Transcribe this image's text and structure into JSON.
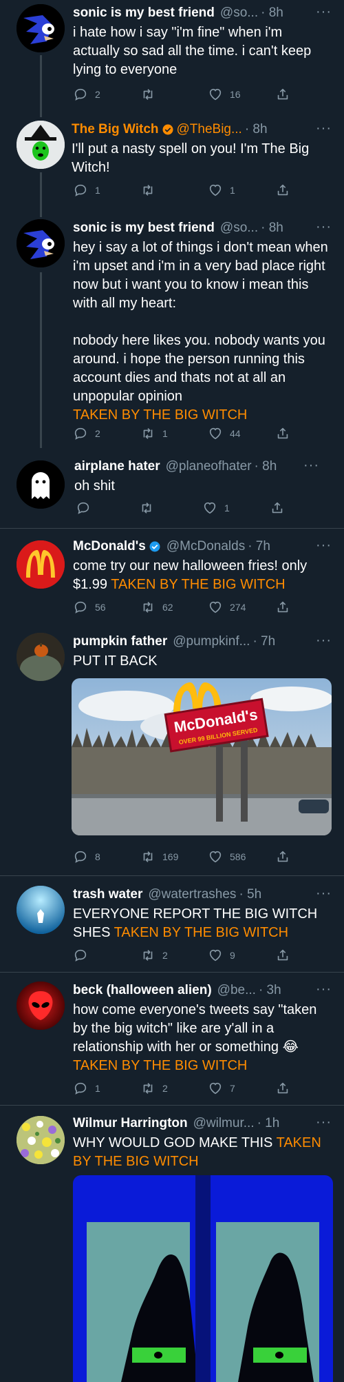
{
  "tweets": [
    {
      "name": "sonic is my best friend",
      "handle": "@so...",
      "time": "· 8h",
      "text": "i hate how i say \"i'm fine\" when i'm actually so sad all the time. i can't keep lying to everyone",
      "witch": "",
      "replies": "2",
      "retweets": "",
      "likes": "16"
    },
    {
      "name": "The Big Witch",
      "handle": "@TheBig...",
      "time": "· 8h",
      "text": "I'll put a nasty spell on you! I'm The Big Witch!",
      "witch": "",
      "replies": "1",
      "retweets": "",
      "likes": "1"
    },
    {
      "name": "sonic is my best friend",
      "handle": "@so...",
      "time": "· 8h",
      "text": "hey i say a lot of things i don't mean when i'm upset and i'm in a very bad place right now but i want you to know i mean this with all my heart:\n\nnobody here likes you. nobody wants you around. i hope the person running this account dies and thats not at all an unpopular opinion",
      "witch": "TAKEN BY THE BIG WITCH",
      "replies": "2",
      "retweets": "1",
      "likes": "44"
    },
    {
      "name": "airplane hater",
      "handle": "@planeofhater",
      "time": "· 8h",
      "text": "oh shit",
      "witch": "",
      "replies": "",
      "retweets": "",
      "likes": "1"
    },
    {
      "name": "McDonald's",
      "handle": "@McDonalds",
      "time": "· 7h",
      "text": "come try our new halloween fries! only $1.99 ",
      "witch": "TAKEN BY THE BIG WITCH",
      "replies": "56",
      "retweets": "62",
      "likes": "274"
    },
    {
      "name": "pumpkin father",
      "handle": "@pumpkinf...",
      "time": "· 7h",
      "text": "PUT IT BACK",
      "witch": "",
      "replies": "8",
      "retweets": "169",
      "likes": "586",
      "sign_text": "McDonald's",
      "sign_sub": "OVER 99 BILLION SERVED"
    },
    {
      "name": "trash water",
      "handle": "@watertrashes",
      "time": "· 5h",
      "text": "EVERYONE REPORT THE BIG WITCH SHES ",
      "witch": "TAKEN BY THE BIG WITCH",
      "replies": "",
      "retweets": "2",
      "likes": "9"
    },
    {
      "name": "beck (halloween alien)",
      "handle": "@be...",
      "time": "· 3h",
      "text": "how come everyone's tweets say \"taken by the big witch\" like are y'all in a relationship with her or something 😂",
      "witch": "TAKEN BY THE BIG WITCH",
      "replies": "1",
      "retweets": "2",
      "likes": "7"
    },
    {
      "name": "Wilmur Harrington",
      "handle": "@wilmur...",
      "time": "· 1h",
      "text": "WHY WOULD GOD MAKE THIS ",
      "witch": "TAKEN BY THE BIG WITCH",
      "replies": "",
      "retweets": "",
      "likes": ""
    }
  ],
  "more_glyph": "···",
  "colors": {
    "background": "#15202b",
    "muted": "#8899a6",
    "accent_orange": "#ff8c00",
    "divider": "#38444d"
  },
  "icons": [
    "reply-icon",
    "retweet-icon",
    "like-icon",
    "share-icon",
    "verified-badge-icon",
    "more-icon"
  ]
}
